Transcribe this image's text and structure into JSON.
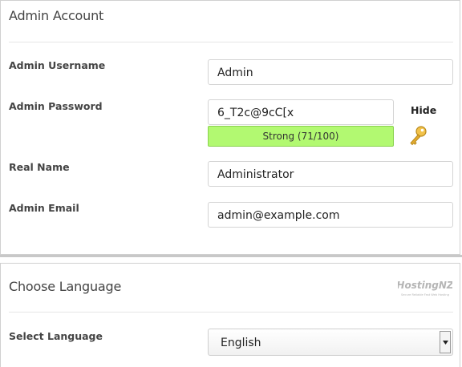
{
  "admin_account": {
    "title": "Admin Account",
    "username": {
      "label": "Admin Username",
      "value": "Admin"
    },
    "password": {
      "label": "Admin Password",
      "value": "6_T2c@9cC[x",
      "strength_text": "Strong (71/100)",
      "strength_score": 71,
      "strength_color": "#b2f971",
      "toggle_label": "Hide",
      "generate_icon": "key-icon"
    },
    "real_name": {
      "label": "Real Name",
      "value": "Administrator"
    },
    "email": {
      "label": "Admin Email",
      "value": "admin@example.com"
    }
  },
  "choose_language": {
    "title": "Choose Language",
    "logo": {
      "brand": "HostingNZ",
      "tagline": "Secure Reliable Fast Web Hosting"
    },
    "select": {
      "label": "Select Language",
      "selected": "English"
    }
  }
}
